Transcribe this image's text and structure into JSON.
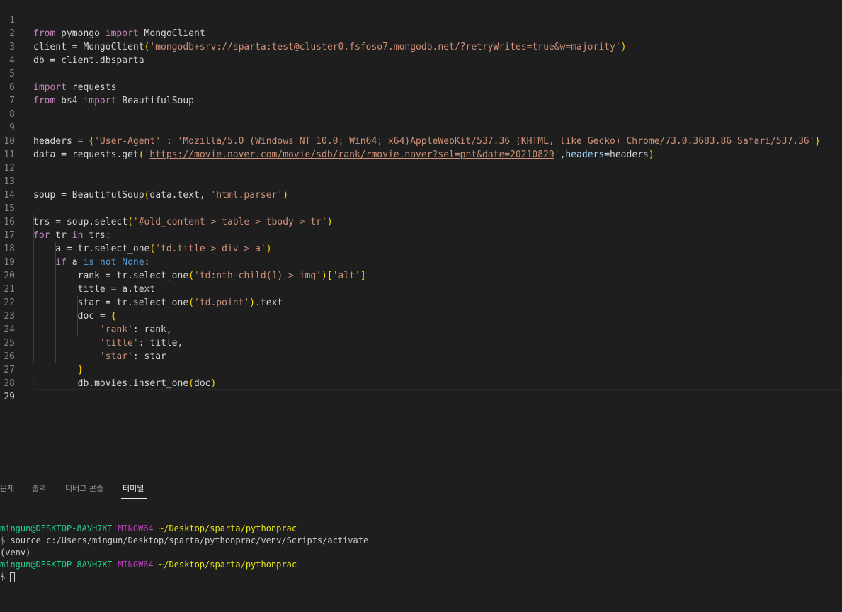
{
  "editor": {
    "line_numbers": [
      "1",
      "2",
      "3",
      "4",
      "5",
      "6",
      "7",
      "8",
      "9",
      "10",
      "11",
      "12",
      "13",
      "14",
      "15",
      "16",
      "17",
      "18",
      "19",
      "20",
      "21",
      "22",
      "23",
      "24",
      "25",
      "26",
      "27",
      "28",
      "29"
    ],
    "l1": {
      "k1": "from",
      "t1": " pymongo ",
      "k2": "import",
      "t2": " MongoClient"
    },
    "l2": {
      "t1": "client = MongoClient",
      "p1": "(",
      "s1": "'mongodb+srv://sparta:test@cluster0.fsfoso7.mongodb.net/?retryWrites=true&w=majority'",
      "p2": ")"
    },
    "l3": {
      "t1": "db = client.dbsparta"
    },
    "l5": {
      "k1": "import",
      "t1": " requests"
    },
    "l6": {
      "k1": "from",
      "t1": " bs4 ",
      "k2": "import",
      "t2": " BeautifulSoup"
    },
    "l9": {
      "t1": "headers = ",
      "p1": "{",
      "s1": "'User-Agent'",
      "t2": " : ",
      "s2": "'Mozilla/5.0 (Windows NT 10.0; Win64; x64)AppleWebKit/537.36 (KHTML, like Gecko) Chrome/73.0.3683.86 Safari/537.36'",
      "p2": "}"
    },
    "l10": {
      "t1": "data = requests.get",
      "p1": "(",
      "q1": "'",
      "u1": "https://movie.naver.com/movie/sdb/rank/rmovie.naver?sel=pnt&date=20210829",
      "q2": "'",
      "t2": ",",
      "a1": "headers",
      "t3": "=headers",
      "p2": ")"
    },
    "l13": {
      "t1": "soup = BeautifulSoup",
      "p1": "(",
      "t2": "data.text, ",
      "s1": "'html.parser'",
      "p2": ")"
    },
    "l15": {
      "t1": "trs = soup.select",
      "p1": "(",
      "s1": "'#old_content > table > tbody > tr'",
      "p2": ")"
    },
    "l16": {
      "k1": "for",
      "t1": " tr ",
      "k2": "in",
      "t2": " trs:"
    },
    "l17": {
      "t0": "    ",
      "t1": "a = tr.select_one",
      "p1": "(",
      "s1": "'td.title > div > a'",
      "p2": ")"
    },
    "l18": {
      "t0": "    ",
      "k1": "if",
      "t1": " a ",
      "k2": "is",
      "t2": " ",
      "k3": "not",
      "t3": " ",
      "k4": "None",
      "t4": ":"
    },
    "l19": {
      "t0": "        ",
      "t1": "rank = tr.select_one",
      "p1": "(",
      "s1": "'td:nth-child(1) > img'",
      "p2": ")",
      "p3": "[",
      "s2": "'alt'",
      "p4": "]"
    },
    "l20": {
      "t0": "        ",
      "t1": "title = a.text"
    },
    "l21": {
      "t0": "        ",
      "t1": "star = tr.select_one",
      "p1": "(",
      "s1": "'td.point'",
      "p2": ")",
      "t2": ".text"
    },
    "l22": {
      "t0": "        ",
      "t1": "doc = ",
      "p1": "{"
    },
    "l23": {
      "t0": "            ",
      "s1": "'rank'",
      "t1": ": rank,"
    },
    "l24": {
      "t0": "            ",
      "s1": "'title'",
      "t1": ": title,"
    },
    "l25": {
      "t0": "            ",
      "s1": "'star'",
      "t1": ": star"
    },
    "l26": {
      "t0": "        ",
      "p1": "}"
    },
    "l27": {
      "t0": "        ",
      "t1": "db.movies.insert_one",
      "p1": "(",
      "t2": "doc",
      "p2": ")"
    }
  },
  "panel": {
    "tabs": [
      "문제",
      "출력",
      "디버그 콘솔",
      "터미널"
    ],
    "active_tab": "터미널"
  },
  "terminal": {
    "user1": "mingun@DESKTOP-8AVH7KI",
    "ming1": "MINGW64",
    "path1": "~/Desktop/sparta/pythonprac",
    "cmd1": "$ source c:/Users/mingun/Desktop/sparta/pythonprac/venv/Scripts/activate",
    "venv": "(venv)",
    "user2": "mingun@DESKTOP-8AVH7KI",
    "ming2": "MINGW64",
    "path2": "~/Desktop/sparta/pythonprac",
    "prompt": "$ "
  },
  "colors": {
    "background": "#1e1e1e",
    "keyword": "#c586c0",
    "string": "#ce9178",
    "bracket_gold": "#ffd700",
    "bracket_purple": "#da70d6",
    "terminal_user": "#23d18b",
    "terminal_mingw": "#bc3fbc",
    "terminal_path": "#e5e510"
  }
}
